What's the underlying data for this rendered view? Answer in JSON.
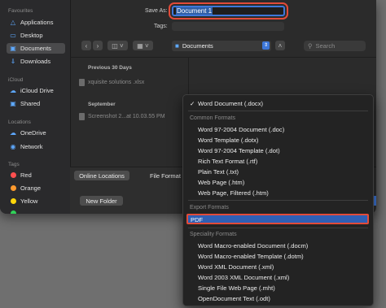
{
  "sidebar": {
    "sections": [
      {
        "heading": "Favourites",
        "items": [
          {
            "label": "Applications",
            "icon": "applications-icon"
          },
          {
            "label": "Desktop",
            "icon": "desktop-icon"
          },
          {
            "label": "Documents",
            "icon": "documents-icon",
            "selected": true
          },
          {
            "label": "Downloads",
            "icon": "downloads-icon"
          }
        ]
      },
      {
        "heading": "iCloud",
        "items": [
          {
            "label": "iCloud Drive",
            "icon": "cloud-icon"
          },
          {
            "label": "Shared",
            "icon": "shared-folder-icon"
          }
        ]
      },
      {
        "heading": "Locations",
        "items": [
          {
            "label": "OneDrive",
            "icon": "cloud-icon"
          },
          {
            "label": "Network",
            "icon": "globe-icon"
          }
        ]
      },
      {
        "heading": "Tags",
        "items": [
          {
            "label": "Red",
            "color": "#ff4f4f"
          },
          {
            "label": "Orange",
            "color": "#ff9a2e"
          },
          {
            "label": "Yellow",
            "color": "#ffd60a"
          },
          {
            "label": "",
            "color": "#30d158"
          }
        ]
      }
    ]
  },
  "form": {
    "save_as_label": "Save As:",
    "save_as_value": "Document 1",
    "tags_label": "Tags:",
    "location": "Documents",
    "search_placeholder": "Search"
  },
  "browser": {
    "groups": [
      {
        "heading": "Previous 30 Days",
        "files": [
          "xquisite solutions .xlsx"
        ]
      },
      {
        "heading": "September",
        "files": [
          "Screenshot 2...at 10.03.55 PM"
        ]
      }
    ]
  },
  "bottom": {
    "online_locations": "Online Locations",
    "file_format_label": "File Format",
    "new_folder": "New Folder"
  },
  "format_menu": {
    "selected": "Word Document (.docx)",
    "common_heading": "Common Formats",
    "common": [
      "Word 97-2004 Document (.doc)",
      "Word Template (.dotx)",
      "Word 97-2004 Template (.dot)",
      "Rich Text Format (.rtf)",
      "Plain Text (.txt)",
      "Web Page (.htm)",
      "Web Page, Filtered (.htm)"
    ],
    "export_heading": "Export Formats",
    "export": [
      "PDF"
    ],
    "specialty_heading": "Speciality Formats",
    "specialty": [
      "Word Macro-enabled Document (.docm)",
      "Word Macro-enabled Template (.dotm)",
      "Word XML Document (.xml)",
      "Word 2003 XML Document (.xml)",
      "Single File Web Page (.mht)",
      "OpenDocument Text (.odt)"
    ],
    "highlight_color": "#2f5fb5",
    "annotation_color": "#e24b39"
  }
}
